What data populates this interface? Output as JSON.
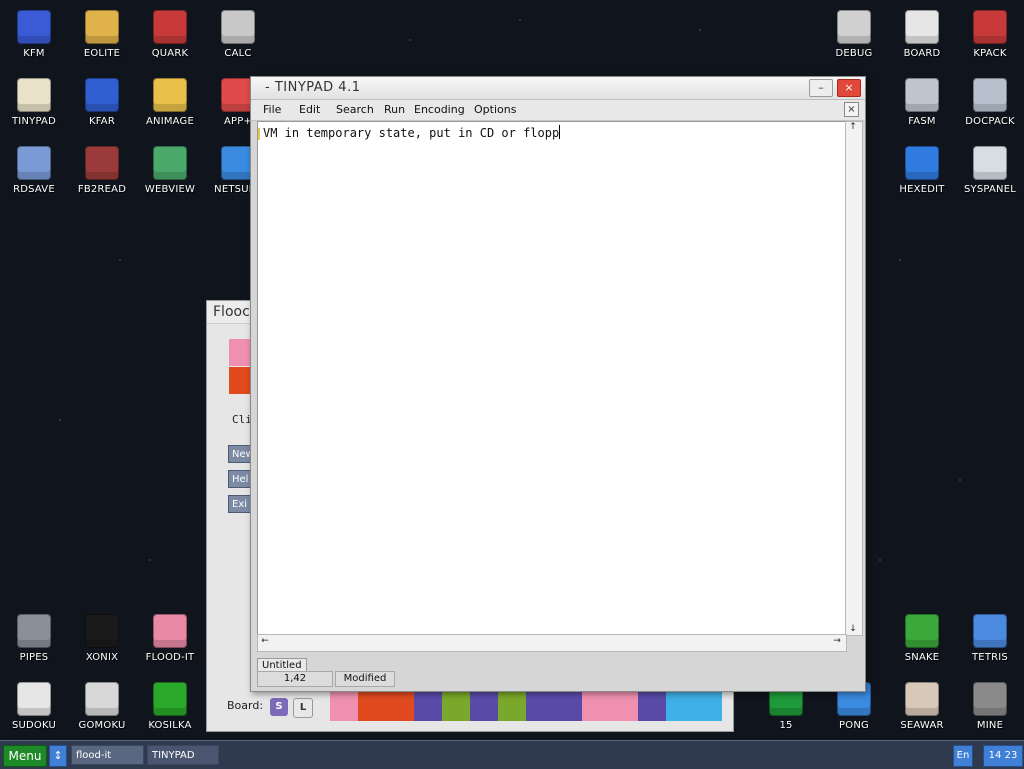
{
  "desktop": {
    "icons": [
      {
        "label": "KFM",
        "icon": "floppy-icon",
        "color": "#3b5bd6"
      },
      {
        "label": "EOLITE",
        "icon": "folder-icon",
        "color": "#e0b24a"
      },
      {
        "label": "QUARK",
        "icon": "book-icon",
        "color": "#c83a3a"
      },
      {
        "label": "CALC",
        "icon": "calculator-icon",
        "color": "#c8c8c8"
      },
      {
        "label": "TINYPAD",
        "icon": "notepad-icon",
        "color": "#e9e2c8"
      },
      {
        "label": "KFAR",
        "icon": "kfar-icon",
        "color": "#2f5fd0"
      },
      {
        "label": "ANIMAGE",
        "icon": "pencil-icon",
        "color": "#e8c04a"
      },
      {
        "label": "APP+",
        "icon": "cube-icon",
        "color": "#e04a4a"
      },
      {
        "label": "RDSAVE",
        "icon": "rdsave-icon",
        "color": "#7a9ad6"
      },
      {
        "label": "FB2READ",
        "icon": "fb2-book-icon",
        "color": "#9a3a3a"
      },
      {
        "label": "WEBVIEW",
        "icon": "globe-map-icon",
        "color": "#4aa86a"
      },
      {
        "label": "NETSURF",
        "icon": "globe-icon",
        "color": "#3a8ae0"
      },
      {
        "label": "DEBUG",
        "icon": "bug-icon",
        "color": "#d0d0d0"
      },
      {
        "label": "BOARD",
        "icon": "board-icon",
        "color": "#e6e6e6"
      },
      {
        "label": "KPACK",
        "icon": "wrench-icon",
        "color": "#c83a3a"
      },
      {
        "label": "FASM",
        "icon": "anvil-icon",
        "color": "#bfc6cf"
      },
      {
        "label": "DOCPACK",
        "icon": "drawer-icon",
        "color": "#b8c2cf"
      },
      {
        "label": "HEXEDIT",
        "icon": "hex-icon",
        "color": "#2f7be0"
      },
      {
        "label": "SYSPANEL",
        "icon": "sliders-icon",
        "color": "#d8dde4"
      },
      {
        "label": "PIPES",
        "icon": "pipes-icon",
        "color": "#8a8f98"
      },
      {
        "label": "XONIX",
        "icon": "xonix-icon",
        "color": "#1a1a1a"
      },
      {
        "label": "FLOOD-IT",
        "icon": "flood-grid-icon",
        "color": "#e88aa6"
      },
      {
        "label": "SNAKE",
        "icon": "snake-icon",
        "color": "#3aa83a"
      },
      {
        "label": "TETRIS",
        "icon": "tetris-icon",
        "color": "#4a8ae0"
      },
      {
        "label": "SUDOKU",
        "icon": "sudoku-icon",
        "color": "#e6e6e6"
      },
      {
        "label": "GOMOKU",
        "icon": "gomoku-icon",
        "color": "#d8d8d8"
      },
      {
        "label": "KOSILKA",
        "icon": "mower-icon",
        "color": "#2aa82a"
      },
      {
        "label": "15",
        "icon": "fifteen-icon",
        "color": "#1e9a3a"
      },
      {
        "label": "PONG",
        "icon": "pong-icon",
        "color": "#3a8ae0"
      },
      {
        "label": "SEAWAR",
        "icon": "ship-icon",
        "color": "#d8c8b8"
      },
      {
        "label": "MINE",
        "icon": "mine-icon",
        "color": "#8a8a8a"
      }
    ]
  },
  "flood_window": {
    "title": "Flooc",
    "click_text": "Cli",
    "buttons": {
      "new": "New",
      "help": "Hel",
      "exit": "Exi"
    },
    "board_label": "Board:",
    "board_small": "S",
    "board_large": "L",
    "swatches": [
      "#f090b0",
      "#e04a1e"
    ],
    "strip_colors": [
      "#f090b0",
      "#e04a1e",
      "#e04a1e",
      "#5a4aa8",
      "#7aa82a",
      "#5a4aa8",
      "#7aa82a",
      "#5a4aa8",
      "#5a4aa8",
      "#f090b0",
      "#f090b0",
      "#5a4aa8",
      "#40b0e8",
      "#40b0e8"
    ]
  },
  "tinypad": {
    "title": "- TINYPAD 4.1",
    "minimize": "–",
    "close": "×",
    "menu": [
      "File",
      "Edit",
      "Search",
      "Run",
      "Encoding",
      "Options"
    ],
    "panel_close": "×",
    "text": "VM in temporary state, put in CD or flopp",
    "tab": "Untitled",
    "status": {
      "position": "1,42",
      "state": "Modified"
    },
    "scroll": {
      "up": "↑",
      "down": "↓",
      "left": "←",
      "right": "→"
    }
  },
  "taskbar": {
    "menu": "Menu",
    "up": "↕",
    "tasks": [
      "flood-it",
      "TINYPAD"
    ],
    "lang": "En",
    "clock": "14 23"
  },
  "colors": {
    "taskbar": "#2f3a4f",
    "menu_button": "#1e8a27",
    "accent": "#3f7fd6"
  }
}
